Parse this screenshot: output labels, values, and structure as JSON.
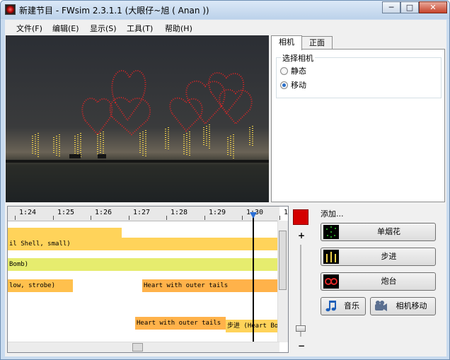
{
  "window": {
    "title": "新建节目 - FWsim 2.3.1.1 (大眼仔~旭 ( Anan ))",
    "controls": {
      "minimize": "─",
      "maximize": "□",
      "close": "✕"
    }
  },
  "menu": [
    "文件(F)",
    "编辑(E)",
    "显示(S)",
    "工具(T)",
    "帮助(H)"
  ],
  "camera_panel": {
    "tabs": [
      "相机",
      "正面"
    ],
    "active_tab": "相机",
    "group_label": "选择相机",
    "options": [
      {
        "label": "静态",
        "checked": false
      },
      {
        "label": "移动",
        "checked": true
      }
    ]
  },
  "timeline": {
    "ticks": [
      "1:24",
      "1:25",
      "1:26",
      "1:27",
      "1:28",
      "1:29",
      "1:30",
      "1:"
    ],
    "tracks": [
      {
        "label": "",
        "color": "#ffd35a"
      },
      {
        "label": "il Shell, small)",
        "color": "#ffd35a"
      },
      {
        "label": "Bomb)",
        "color": "#e6ec6e"
      },
      {
        "label": "low, strobe)",
        "color": "#ffc04d"
      },
      {
        "label": "Heart with outer tails",
        "color": "#ffb24a"
      },
      {
        "label": "Heart with outer tails",
        "color": "#ffb24a"
      },
      {
        "label": "步进  (Heart Bo",
        "color": "#ffd35a"
      }
    ],
    "zoom_plus": "+",
    "zoom_minus": "−"
  },
  "add_panel": {
    "label": "添加...",
    "buttons": {
      "single": "单烟花",
      "step": "步进",
      "mortar": "炮台",
      "music": "音乐",
      "camera_move": "相机移动"
    }
  },
  "colors": {
    "record_swatch": "#d40000",
    "playhead_marker": "#2b6fd6"
  }
}
